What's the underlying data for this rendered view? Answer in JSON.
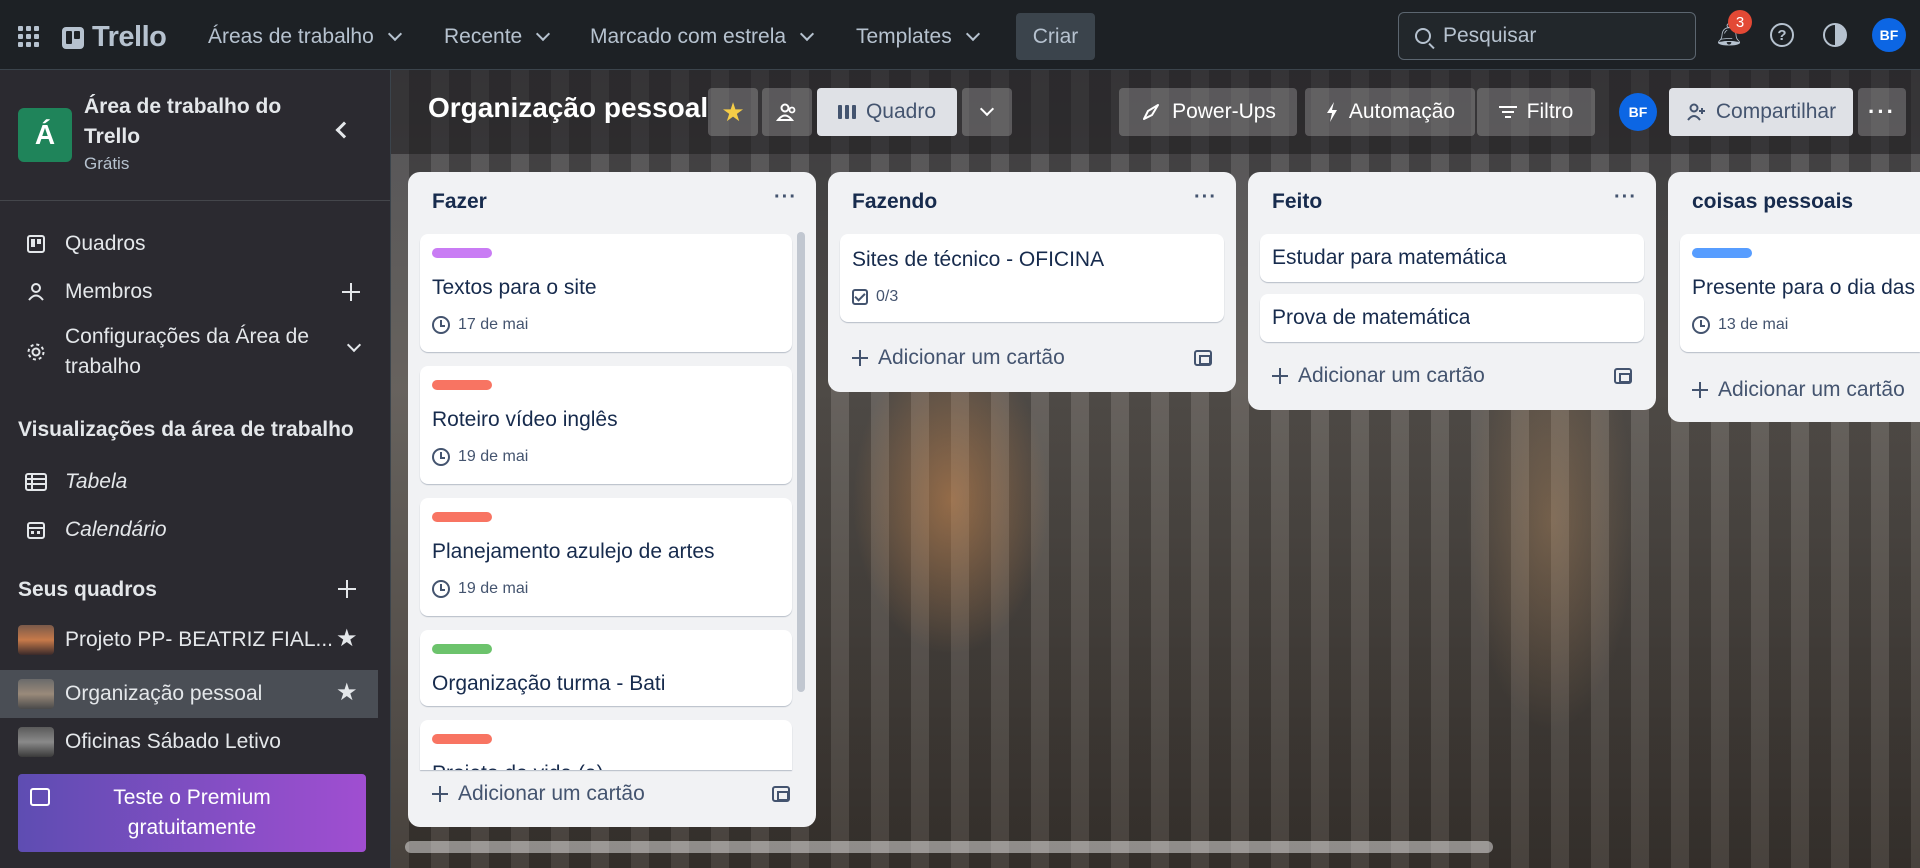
{
  "topnav": {
    "brand": "Trello",
    "menus": [
      "Áreas de trabalho",
      "Recente",
      "Marcado com estrela",
      "Templates"
    ],
    "create_label": "Criar",
    "search_placeholder": "Pesquisar",
    "notification_count": "3",
    "avatar_initials": "BF"
  },
  "sidebar": {
    "workspace_initial": "Á",
    "workspace_name": "Área de trabalho do Trello",
    "workspace_plan": "Grátis",
    "nav": [
      {
        "label": "Quadros"
      },
      {
        "label": "Membros"
      },
      {
        "label": "Configurações da Área de trabalho"
      }
    ],
    "views_title": "Visualizações da área de trabalho",
    "views": [
      {
        "label": "Tabela"
      },
      {
        "label": "Calendário"
      }
    ],
    "boards_title": "Seus quadros",
    "boards": [
      {
        "label": "Projeto PP- BEATRIZ FIAL..."
      },
      {
        "label": "Organização pessoal"
      },
      {
        "label": "Oficinas Sábado Letivo"
      }
    ],
    "premium_label": "Teste o Premium gratuitamente"
  },
  "board": {
    "title": "Organização pessoal",
    "view_label": "Quadro",
    "powerups_label": "Power-Ups",
    "automation_label": "Automação",
    "filter_label": "Filtro",
    "member_initials": "BF",
    "share_label": "Compartilhar"
  },
  "lists": [
    {
      "title": "Fazer",
      "add_label": "Adicionar um cartão",
      "cards": [
        {
          "title": "Textos para o site",
          "label_color": "#c97cf4",
          "due": "17 de mai"
        },
        {
          "title": "Roteiro vídeo inglês",
          "label_color": "#f87462",
          "due": "19 de mai"
        },
        {
          "title": "Planejamento azulejo de artes",
          "label_color": "#f87462",
          "due": "19 de mai"
        },
        {
          "title": "Organização turma - Bati",
          "label_color": "#6cc36c"
        },
        {
          "title": "Projeto de vida (a)",
          "label_color": "#f87462"
        }
      ]
    },
    {
      "title": "Fazendo",
      "add_label": "Adicionar um cartão",
      "cards": [
        {
          "title": "Sites de técnico - OFICINA",
          "checklist": "0/3"
        }
      ]
    },
    {
      "title": "Feito",
      "add_label": "Adicionar um cartão",
      "cards": [
        {
          "title": "Estudar para matemática"
        },
        {
          "title": "Prova de matemática"
        }
      ]
    },
    {
      "title": "coisas pessoais",
      "add_label": "Adicionar um cartão",
      "cards": [
        {
          "title": "Presente para o dia das mães",
          "label_color": "#579dff",
          "due": "13 de mai"
        }
      ]
    }
  ]
}
